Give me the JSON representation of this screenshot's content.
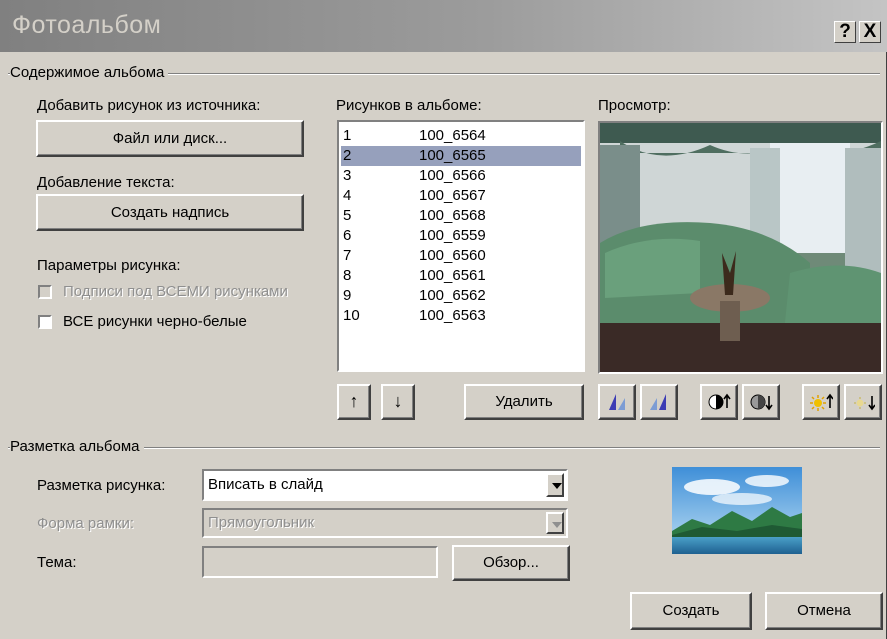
{
  "window": {
    "title": "Фотоальбом",
    "help_glyph": "?",
    "close_glyph": "X"
  },
  "content_group": {
    "label": "Содержимое альбома",
    "add_picture_label": "Добавить рисунок из источника:",
    "file_button": "Файл или диск...",
    "add_text_label": "Добавление текста:",
    "textbox_button": "Создать надпись",
    "picture_options_label": "Параметры рисунка:",
    "captions_checkbox": {
      "label": "Подписи под ВСЕМИ рисунками",
      "checked": false,
      "enabled": false
    },
    "bw_checkbox": {
      "label": "ВСЕ рисунки черно-белые",
      "checked": false,
      "enabled": true
    }
  },
  "pictures": {
    "label": "Рисунков в альбоме:",
    "selected_index": 1,
    "items": [
      {
        "num": "1",
        "name": "100_6564"
      },
      {
        "num": "2",
        "name": "100_6565"
      },
      {
        "num": "3",
        "name": "100_6566"
      },
      {
        "num": "4",
        "name": "100_6567"
      },
      {
        "num": "5",
        "name": "100_6568"
      },
      {
        "num": "6",
        "name": "100_6559"
      },
      {
        "num": "7",
        "name": "100_6560"
      },
      {
        "num": "8",
        "name": "100_6561"
      },
      {
        "num": "9",
        "name": "100_6562"
      },
      {
        "num": "10",
        "name": "100_6563"
      }
    ],
    "move_up_glyph": "↑",
    "move_down_glyph": "↓",
    "delete_button": "Удалить"
  },
  "preview": {
    "label": "Просмотр:",
    "tools": [
      "rotate-left-icon",
      "rotate-right-icon",
      "contrast-up-icon",
      "contrast-down-icon",
      "brightness-up-icon",
      "brightness-down-icon"
    ]
  },
  "layout_group": {
    "label": "Разметка альбома",
    "picture_layout_label": "Разметка рисунка:",
    "picture_layout_value": "Вписать в слайд",
    "frame_shape_label": "Форма рамки:",
    "frame_shape_value": "Прямоугольник",
    "theme_label": "Тема:",
    "theme_value": "",
    "browse_button": "Обзор..."
  },
  "footer": {
    "create_button": "Создать",
    "cancel_button": "Отмена"
  },
  "colors": {
    "dialog_bg": "#d4d0c8",
    "selection": "#96a0bc",
    "titlebar": "#808080"
  }
}
